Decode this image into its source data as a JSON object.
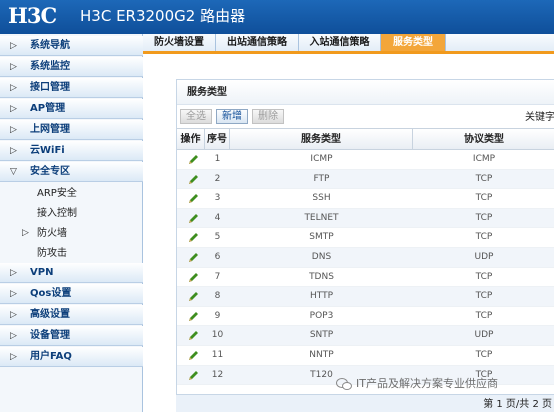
{
  "header": {
    "logo": "H3C",
    "title": "H3C ER3200G2 路由器"
  },
  "sidebar": {
    "items": [
      {
        "label": "系统导航",
        "arrow": "▷"
      },
      {
        "label": "系统监控",
        "arrow": "▷"
      },
      {
        "label": "接口管理",
        "arrow": "▷"
      },
      {
        "label": "AP管理",
        "arrow": "▷"
      },
      {
        "label": "上网管理",
        "arrow": "▷"
      },
      {
        "label": "云WiFi",
        "arrow": "▷"
      },
      {
        "label": "安全专区",
        "arrow": "▽"
      },
      {
        "label": "VPN",
        "arrow": "▷"
      },
      {
        "label": "Qos设置",
        "arrow": "▷"
      },
      {
        "label": "高级设置",
        "arrow": "▷"
      },
      {
        "label": "设备管理",
        "arrow": "▷"
      },
      {
        "label": "用户FAQ",
        "arrow": "▷"
      }
    ],
    "subitems": [
      {
        "label": "ARP安全",
        "arrow": ""
      },
      {
        "label": "接入控制",
        "arrow": ""
      },
      {
        "label": "防火墙",
        "arrow": "▷"
      },
      {
        "label": "防攻击",
        "arrow": ""
      }
    ]
  },
  "tabs": [
    {
      "label": "防火墙设置"
    },
    {
      "label": "出站通信策略"
    },
    {
      "label": "入站通信策略"
    },
    {
      "label": "服务类型"
    }
  ],
  "panel": {
    "title": "服务类型",
    "buttons": {
      "select_all": "全选",
      "add": "新增",
      "delete": "删除"
    },
    "keyword_label": "关键字"
  },
  "table": {
    "headers": [
      "操作",
      "序号",
      "服务类型",
      "协议类型"
    ],
    "rows": [
      {
        "index": "1",
        "service": "ICMP",
        "protocol": "ICMP"
      },
      {
        "index": "2",
        "service": "FTP",
        "protocol": "TCP"
      },
      {
        "index": "3",
        "service": "SSH",
        "protocol": "TCP"
      },
      {
        "index": "4",
        "service": "TELNET",
        "protocol": "TCP"
      },
      {
        "index": "5",
        "service": "SMTP",
        "protocol": "TCP"
      },
      {
        "index": "6",
        "service": "DNS",
        "protocol": "UDP"
      },
      {
        "index": "7",
        "service": "TDNS",
        "protocol": "TCP"
      },
      {
        "index": "8",
        "service": "HTTP",
        "protocol": "TCP"
      },
      {
        "index": "9",
        "service": "POP3",
        "protocol": "TCP"
      },
      {
        "index": "10",
        "service": "SNTP",
        "protocol": "UDP"
      },
      {
        "index": "11",
        "service": "NNTP",
        "protocol": "TCP"
      },
      {
        "index": "12",
        "service": "T120",
        "protocol": "TCP"
      }
    ]
  },
  "footer": {
    "pager": "第 1 页/共 2 页"
  },
  "watermark": {
    "text": "IT产品及解决方案专业供应商"
  },
  "colors": {
    "header_blue": "#1d68b8",
    "active_tab": "#f3a63a",
    "edit_icon": "#3e8e1f"
  }
}
